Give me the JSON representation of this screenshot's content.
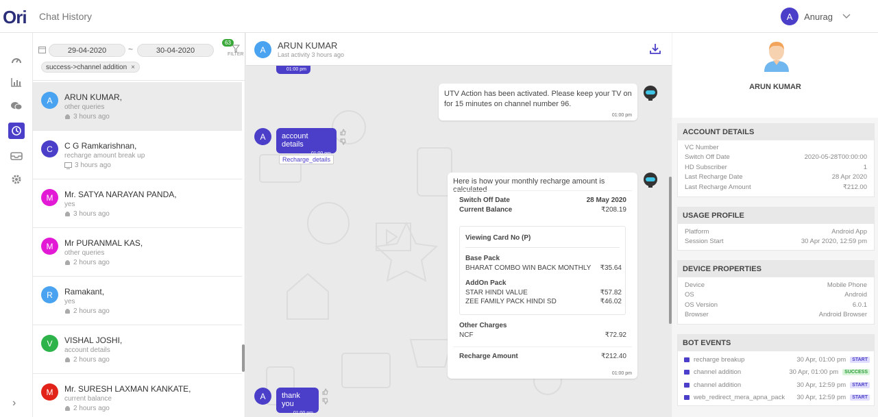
{
  "app": {
    "logo": "Ori",
    "page_title": "Chat History"
  },
  "user": {
    "initial": "A",
    "name": "Anurag"
  },
  "filters": {
    "date_from": "29-04-2020",
    "date_separator": "~",
    "date_to": "30-04-2020",
    "filter_count": "63",
    "filter_label": "FILTER",
    "chip_label": "success->channel addition",
    "chip_remove": "×"
  },
  "conversations": [
    {
      "initial": "A",
      "name": "ARUN KUMAR",
      "subtitle": "other queries",
      "time": "3 hours ago",
      "color": "#4aa3f0",
      "platform": "android"
    },
    {
      "initial": "C",
      "name": "C G Ramkarishnan",
      "subtitle": "recharge amount break up",
      "time": "3 hours ago",
      "color": "#4b3fc9",
      "platform": "desktop"
    },
    {
      "initial": "M",
      "name": "Mr. SATYA NARAYAN PANDA",
      "subtitle": "yes",
      "time": "3 hours ago",
      "color": "#e21ad6",
      "platform": "android"
    },
    {
      "initial": "M",
      "name": "Mr PURANMAL KAS",
      "subtitle": "other queries",
      "time": "2 hours ago",
      "color": "#e21ad6",
      "platform": "android"
    },
    {
      "initial": "R",
      "name": "Ramakant",
      "subtitle": "yes",
      "time": "2 hours ago",
      "color": "#4aa3f0",
      "platform": "android"
    },
    {
      "initial": "V",
      "name": "VISHAL JOSHI",
      "subtitle": "account details",
      "time": "2 hours ago",
      "color": "#2eb34a",
      "platform": "android"
    },
    {
      "initial": "M",
      "name": "Mr. SURESH LAXMAN KANKATE",
      "subtitle": "current balance",
      "time": "2 hours ago",
      "color": "#e2231a",
      "platform": "android"
    }
  ],
  "chat": {
    "header": {
      "initial": "A",
      "name": "ARUN KUMAR",
      "activity": "Last activity 3 hours ago"
    },
    "messages": {
      "m0_time": "01:00 pm",
      "m1_text": "UTV Action has been activated. Please keep your TV on for 15 minutes on channel number 96.",
      "m1_time": "01:00 pm",
      "m2_initial": "A",
      "m2_text": "account details",
      "m2_time": "01:00 pm",
      "m2_tag": "Recharge_details",
      "m3_title": "Here is how your monthly recharge amount is calculated",
      "m3_switch_off_label": "Switch Off Date",
      "m3_switch_off_value": "28 May 2020",
      "m3_balance_label": "Current Balance",
      "m3_balance_value": "₹208.19",
      "m3_card_title": "Viewing Card No (P)",
      "m3_base_pack_label": "Base Pack",
      "m3_base_pack_name": "BHARAT COMBO WIN BACK MONTHLY",
      "m3_base_pack_value": "₹35.64",
      "m3_addon_label": "AddOn Pack",
      "m3_addon1_name": "STAR HINDI VALUE",
      "m3_addon1_value": "₹57.82",
      "m3_addon2_name": "ZEE FAMILY PACK HINDI SD",
      "m3_addon2_value": "₹46.02",
      "m3_other_label": "Other Charges",
      "m3_ncf_label": "NCF",
      "m3_ncf_value": "₹72.92",
      "m3_total_label": "Recharge Amount",
      "m3_total_value": "₹212.40",
      "m3_time": "01:00 pm",
      "m4_initial": "A",
      "m4_text": "thank you",
      "m4_time": "01:00 pm"
    }
  },
  "profile": {
    "name": "ARUN KUMAR"
  },
  "account_details": {
    "title": "ACCOUNT DETAILS",
    "rows": [
      {
        "k": "VC Number",
        "v": ""
      },
      {
        "k": "Switch Off Date",
        "v": "2020-05-28T00:00:00"
      },
      {
        "k": "HD Subscriber",
        "v": "1"
      },
      {
        "k": "Last Recharge Date",
        "v": "28 Apr 2020"
      },
      {
        "k": "Last Recharge Amount",
        "v": "₹212.00"
      }
    ]
  },
  "usage_profile": {
    "title": "USAGE PROFILE",
    "rows": [
      {
        "k": "Platform",
        "v": "Android App"
      },
      {
        "k": "Session Start",
        "v": "30 Apr 2020, 12:59 pm"
      }
    ]
  },
  "device_properties": {
    "title": "DEVICE PROPERTIES",
    "rows": [
      {
        "k": "Device",
        "v": "Mobile Phone"
      },
      {
        "k": "OS",
        "v": "Android"
      },
      {
        "k": "OS Version",
        "v": "6.0.1"
      },
      {
        "k": "Browser",
        "v": "Android Browser"
      }
    ]
  },
  "bot_events": {
    "title": "BOT EVENTS",
    "rows": [
      {
        "name": "recharge breakup",
        "time": "30 Apr, 01:00 pm",
        "badge": "START",
        "kind": "start"
      },
      {
        "name": "channel addition",
        "time": "30 Apr, 01:00 pm",
        "badge": "SUCCESS",
        "kind": "success"
      },
      {
        "name": "channel addition",
        "time": "30 Apr, 12:59 pm",
        "badge": "START",
        "kind": "start"
      },
      {
        "name": "web_redirect_mera_apna_pack",
        "time": "30 Apr, 12:59 pm",
        "badge": "START",
        "kind": "start"
      }
    ]
  },
  "colors": {
    "accent": "#4b3fc9",
    "success": "#2c9b37"
  },
  "icons": {
    "rail": [
      "dashboard-icon",
      "analytics-icon",
      "chat-icon",
      "history-icon",
      "inbox-icon",
      "settings-icon"
    ],
    "expand": "›"
  }
}
